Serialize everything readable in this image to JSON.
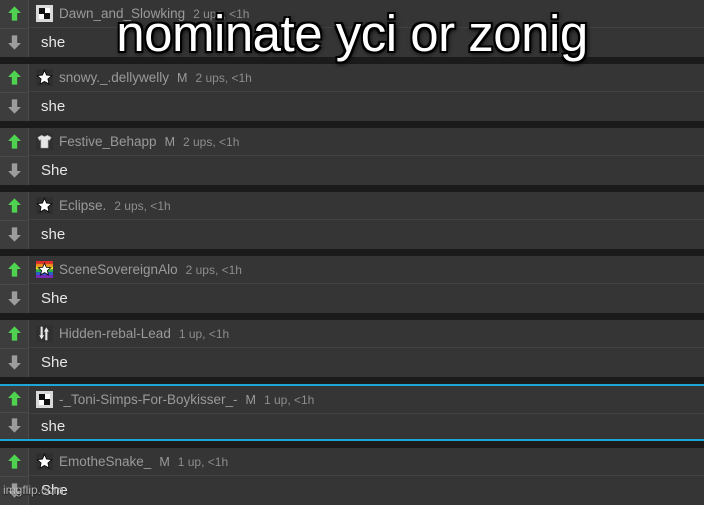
{
  "meme": {
    "caption": "nominate yci or zonig",
    "watermark": "imgflip.com"
  },
  "colors": {
    "upvote": "#4fd24f",
    "downvote": "#9c9c9c",
    "row_background": "#353535",
    "page_background": "#1b1b1b",
    "highlight_border": "#1ba6d6",
    "username": "#9a9a9a",
    "comment_text": "#e8e8e8"
  },
  "comments": [
    {
      "username": "Dawn_and_Slowking",
      "mod_badge": "",
      "stats": "2 ups, <1h",
      "text": "she",
      "avatar": "checker-square-avatar",
      "upvote_label": "upvote",
      "downvote_label": "downvote",
      "highlighted": false
    },
    {
      "username": "snowy._.dellywelly",
      "mod_badge": "M",
      "stats": "2 ups, <1h",
      "text": "she",
      "avatar": "star-avatar",
      "upvote_label": "upvote",
      "downvote_label": "downvote",
      "highlighted": false
    },
    {
      "username": "Festive_Behapp",
      "mod_badge": "M",
      "stats": "2 ups, <1h",
      "text": "She",
      "avatar": "shirt-avatar",
      "upvote_label": "upvote",
      "downvote_label": "downvote",
      "highlighted": false
    },
    {
      "username": "Eclipse.",
      "mod_badge": "",
      "stats": "2 ups, <1h",
      "text": "she",
      "avatar": "star-avatar",
      "upvote_label": "upvote",
      "downvote_label": "downvote",
      "highlighted": false
    },
    {
      "username": "SceneSovereignAlo",
      "mod_badge": "",
      "stats": "2 ups, <1h",
      "text": "She",
      "avatar": "rainbow-star-avatar",
      "upvote_label": "upvote",
      "downvote_label": "downvote",
      "highlighted": false
    },
    {
      "username": "Hidden-rebal-Lead",
      "mod_badge": "",
      "stats": "1 up, <1h",
      "text": "She",
      "avatar": "double-arrow-avatar",
      "upvote_label": "upvote",
      "downvote_label": "downvote",
      "highlighted": false
    },
    {
      "username": "-_Toni-Simps-For-Boykisser_-",
      "mod_badge": "M",
      "stats": "1 up, <1h",
      "text": "she",
      "avatar": "checker-square-avatar",
      "upvote_label": "upvote",
      "downvote_label": "downvote",
      "highlighted": true
    },
    {
      "username": "EmotheSnake_",
      "mod_badge": "M",
      "stats": "1 up, <1h",
      "text": "She",
      "avatar": "star-avatar",
      "upvote_label": "upvote",
      "downvote_label": "downvote",
      "highlighted": false
    }
  ]
}
